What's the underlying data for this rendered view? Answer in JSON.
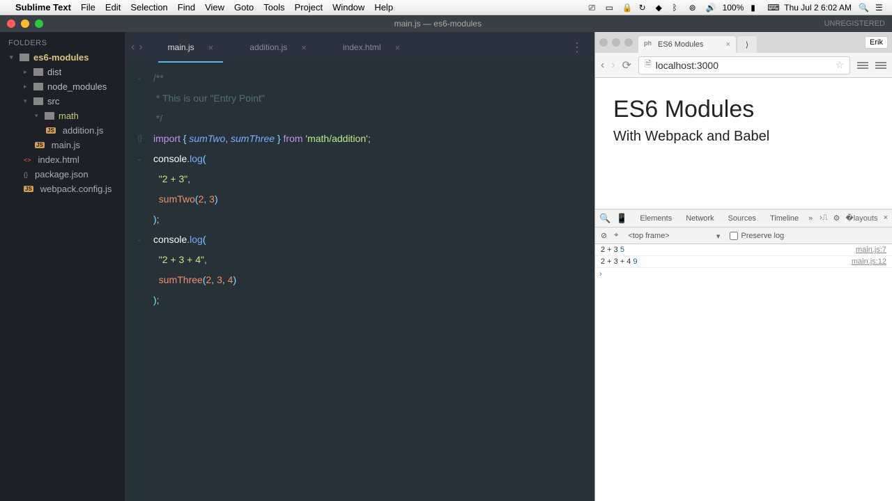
{
  "menubar": {
    "app_name": "Sublime Text",
    "items": [
      "File",
      "Edit",
      "Selection",
      "Find",
      "View",
      "Goto",
      "Tools",
      "Project",
      "Window",
      "Help"
    ],
    "battery": "100%",
    "clock": "Thu Jul 2  6:02 AM"
  },
  "titlebar": {
    "title": "main.js — es6-modules",
    "status": "UNREGISTERED"
  },
  "sidebar": {
    "header": "FOLDERS",
    "tree": {
      "root": "es6-modules",
      "items": [
        {
          "name": "dist",
          "type": "folder",
          "depth": 1
        },
        {
          "name": "node_modules",
          "type": "folder",
          "depth": 1
        },
        {
          "name": "src",
          "type": "folder",
          "depth": 1,
          "open": true
        },
        {
          "name": "math",
          "type": "folder",
          "depth": 2,
          "open": true,
          "highlight": true
        },
        {
          "name": "addition.js",
          "type": "js",
          "depth": 3
        },
        {
          "name": "main.js",
          "type": "js",
          "depth": 2,
          "active": true
        },
        {
          "name": "index.html",
          "type": "html",
          "depth": 1
        },
        {
          "name": "package.json",
          "type": "json",
          "depth": 1
        },
        {
          "name": "webpack.config.js",
          "type": "js",
          "depth": 1
        }
      ]
    }
  },
  "tabs": [
    {
      "label": "main.js",
      "active": true
    },
    {
      "label": "addition.js",
      "active": false
    },
    {
      "label": "index.html",
      "active": false
    }
  ],
  "code": {
    "lines": [
      {
        "fold": "⌄",
        "html": "<span class='c-comment'>/**</span>"
      },
      {
        "fold": "",
        "html": "<span class='c-comment'> * This is our \"Entry Point\"</span>"
      },
      {
        "fold": "",
        "html": "<span class='c-comment'> */</span>"
      },
      {
        "fold": "",
        "html": ""
      },
      {
        "fold": "{}",
        "html": "<span class='c-keyword'>import</span> <span class='c-punc'>{</span> <span class='c-import-name'>sumTwo</span><span class='c-punc'>,</span> <span class='c-import-name'>sumThree</span> <span class='c-punc'>}</span> <span class='c-keyword'>from</span> <span class='c-string'>'math/addition'</span><span class='c-punc'>;</span>"
      },
      {
        "fold": "",
        "html": ""
      },
      {
        "fold": "⌄",
        "html": "<span class='c-obj'>console</span><span class='c-punc'>.</span><span class='c-func'>log</span><span class='c-punc'>(</span>"
      },
      {
        "fold": "",
        "html": "  <span class='c-string'>\"2 + 3\"</span><span class='c-punc'>,</span>"
      },
      {
        "fold": "",
        "html": "  <span class='c-func2'>sumTwo</span><span class='c-punc'>(</span><span class='c-num'>2</span><span class='c-punc'>,</span> <span class='c-num'>3</span><span class='c-punc'>)</span>"
      },
      {
        "fold": "",
        "html": "<span class='c-punc'>);</span>"
      },
      {
        "fold": "",
        "html": ""
      },
      {
        "fold": "⌄",
        "html": "<span class='c-obj'>console</span><span class='c-punc'>.</span><span class='c-func'>log</span><span class='c-punc'>(</span>"
      },
      {
        "fold": "",
        "html": "  <span class='c-string'>\"2 + 3 + 4\"</span><span class='c-punc'>,</span>"
      },
      {
        "fold": "",
        "html": "  <span class='c-func2'>sumThree</span><span class='c-punc'>(</span><span class='c-num'>2</span><span class='c-punc'>,</span> <span class='c-num'>3</span><span class='c-punc'>,</span> <span class='c-num'>4</span><span class='c-punc'>)</span>"
      },
      {
        "fold": "",
        "html": "<span class='c-punc'>);</span>"
      }
    ]
  },
  "browser": {
    "tab_title": "ES6 Modules",
    "user": "Erik",
    "url": "localhost:3000",
    "page": {
      "h1": "ES6 Modules",
      "sub": "With Webpack and Babel"
    }
  },
  "devtools": {
    "tabs": [
      "Elements",
      "Network",
      "Sources",
      "Timeline"
    ],
    "active_tab": "Console",
    "frame": "<top frame>",
    "preserve_label": "Preserve log",
    "console": [
      {
        "text": "2 + 3 ",
        "result": "5",
        "src": "main.js:7"
      },
      {
        "text": "2 + 3 + 4 ",
        "result": "9",
        "src": "main.js:12"
      }
    ]
  }
}
